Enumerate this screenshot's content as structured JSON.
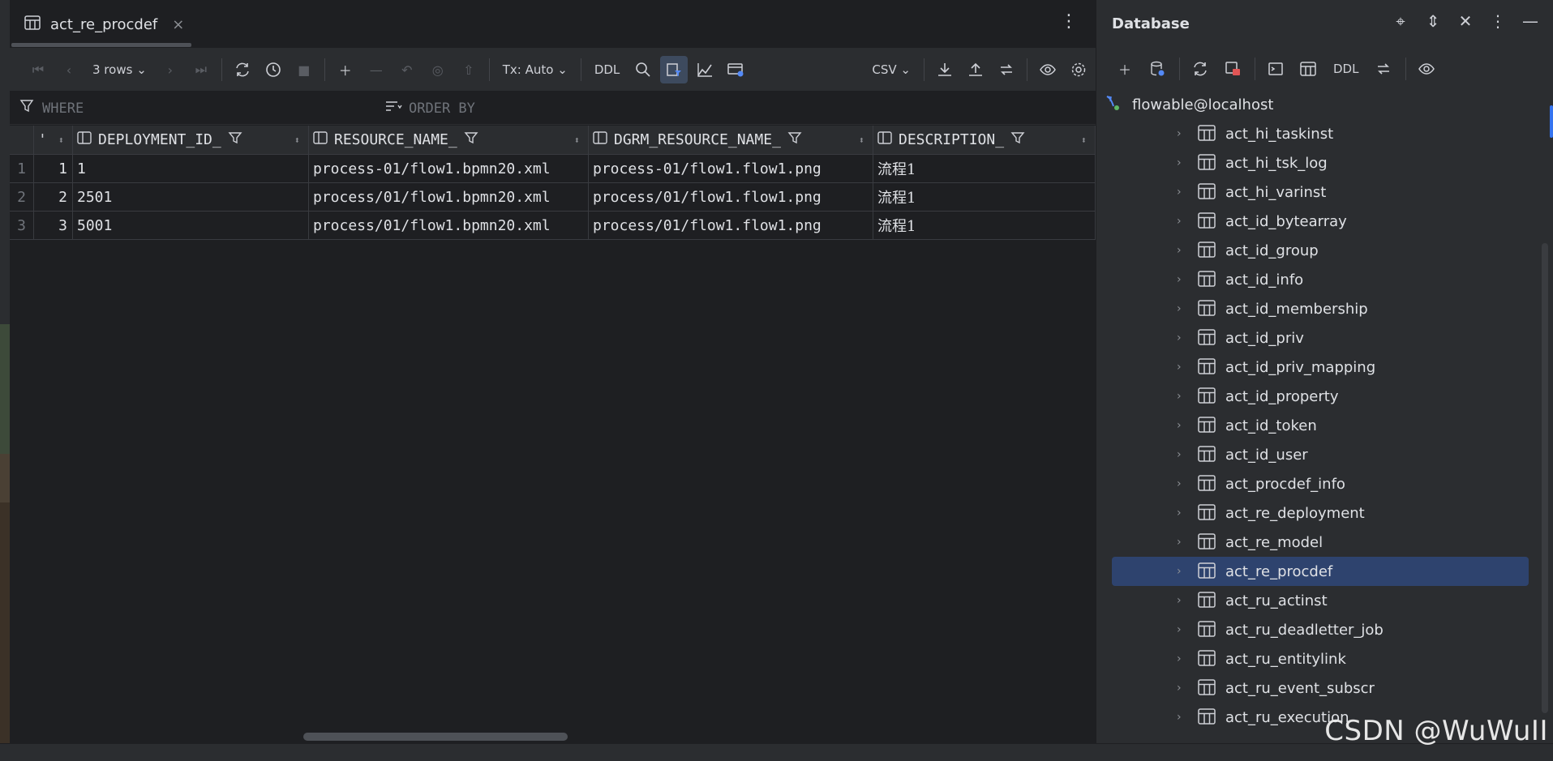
{
  "tab": {
    "title": "act_re_procdef",
    "close": "×",
    "more": "⋮"
  },
  "toolbar": {
    "rows_label": "3 rows",
    "tx_label": "Tx: Auto",
    "ddl_label": "DDL",
    "csv_label": "CSV"
  },
  "filter": {
    "where": "WHERE",
    "order_by": "ORDER BY"
  },
  "grid": {
    "columns": [
      "DEPLOYMENT_ID_",
      "RESOURCE_NAME_",
      "DGRM_RESOURCE_NAME_",
      "DESCRIPTION_"
    ],
    "partial_column": "'",
    "rows": [
      {
        "rownum": "1",
        "id": "1",
        "deployment_id": "1",
        "resource_name": "process-01/flow1.bpmn20.xml",
        "dgrm_resource_name": "process-01/flow1.flow1.png",
        "description": "流程1"
      },
      {
        "rownum": "2",
        "id": "2",
        "deployment_id": "2501",
        "resource_name": "process/01/flow1.bpmn20.xml",
        "dgrm_resource_name": "process/01/flow1.flow1.png",
        "description": "流程1"
      },
      {
        "rownum": "3",
        "id": "3",
        "deployment_id": "5001",
        "resource_name": "process/01/flow1.bpmn20.xml",
        "dgrm_resource_name": "process/01/flow1.flow1.png",
        "description": "流程1"
      }
    ]
  },
  "db": {
    "title": "Database",
    "ddl_label": "DDL",
    "connection": "flowable@localhost",
    "tables": [
      "act_hi_taskinst",
      "act_hi_tsk_log",
      "act_hi_varinst",
      "act_id_bytearray",
      "act_id_group",
      "act_id_info",
      "act_id_membership",
      "act_id_priv",
      "act_id_priv_mapping",
      "act_id_property",
      "act_id_token",
      "act_id_user",
      "act_procdef_info",
      "act_re_deployment",
      "act_re_model",
      "act_re_procdef",
      "act_ru_actinst",
      "act_ru_deadletter_job",
      "act_ru_entitylink",
      "act_ru_event_subscr",
      "act_ru_execution"
    ],
    "selected_table": "act_re_procdef"
  },
  "watermark": "CSDN @WuWuII"
}
